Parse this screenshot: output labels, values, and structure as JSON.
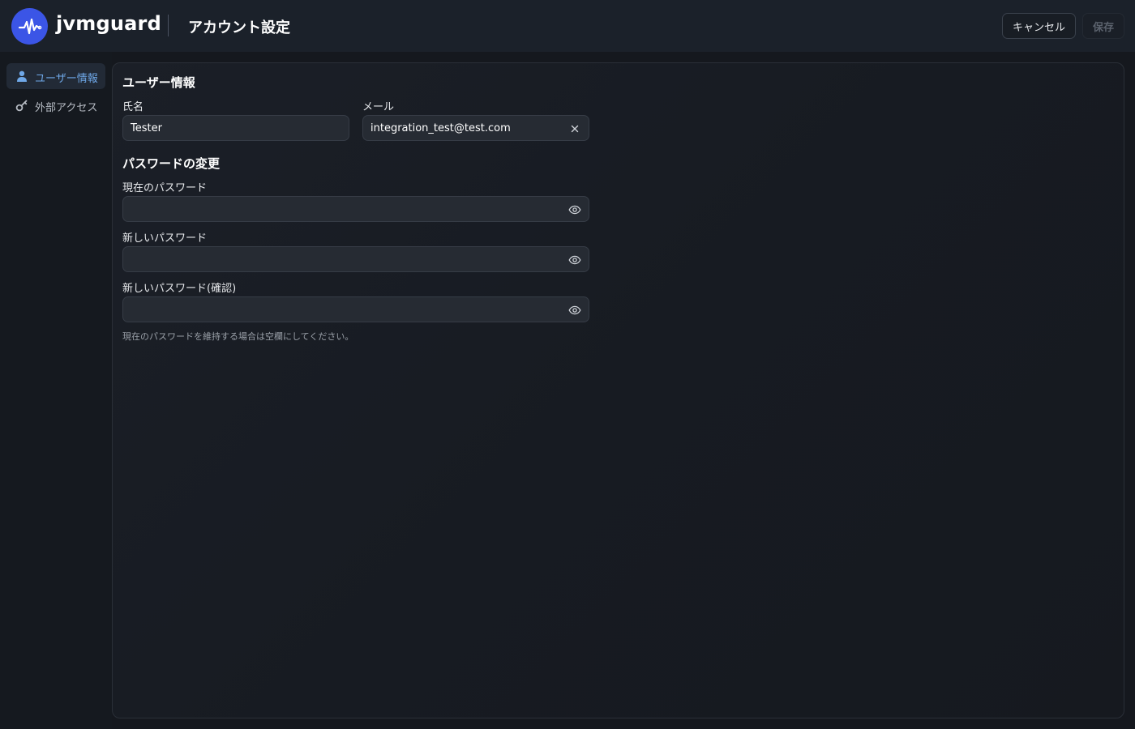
{
  "header": {
    "brand": "jvmguard",
    "page_title": "アカウント設定",
    "cancel_label": "キャンセル",
    "save_label": "保存",
    "logo_icon": "pulse-icon",
    "accent_color": "#3b55e6"
  },
  "sidebar": {
    "items": [
      {
        "label": "ユーザー情報",
        "icon": "user-icon",
        "active": true
      },
      {
        "label": "外部アクセス",
        "icon": "key-icon",
        "active": false
      }
    ]
  },
  "user_info": {
    "section_title": "ユーザー情報",
    "name_label": "氏名",
    "name_value": "Tester",
    "email_label": "メール",
    "email_value": "integration_test@test.com",
    "email_clear_icon": "close-icon"
  },
  "password": {
    "section_title": "パスワードの変更",
    "current_label": "現在のパスワード",
    "new_label": "新しいパスワード",
    "confirm_label": "新しいパスワード(確認)",
    "toggle_icon": "eye-icon",
    "hint": "現在のパスワードを維持する場合は空欄にしてください。"
  }
}
